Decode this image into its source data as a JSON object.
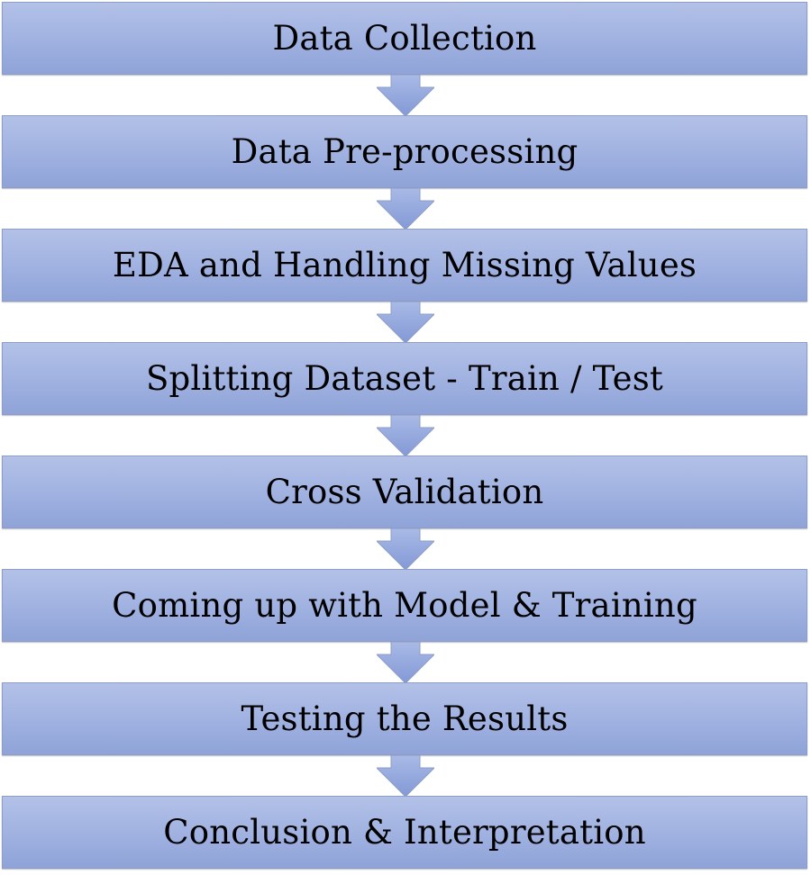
{
  "steps": [
    {
      "label": "Data Collection"
    },
    {
      "label": "Data Pre-processing"
    },
    {
      "label": "EDA and Handling Missing Values"
    },
    {
      "label": "Splitting Dataset - Train / Test"
    },
    {
      "label": "Cross Validation"
    },
    {
      "label": "Coming up with Model & Training"
    },
    {
      "label": "Testing the Results"
    },
    {
      "label": "Conclusion & Interpretation"
    }
  ],
  "colors": {
    "box_top": "#b3c1e7",
    "box_bottom": "#8fa3d8",
    "arrow": "#93a8dd",
    "border": "#8e9dc4"
  },
  "icons": {
    "connector": "down-arrow-icon"
  }
}
